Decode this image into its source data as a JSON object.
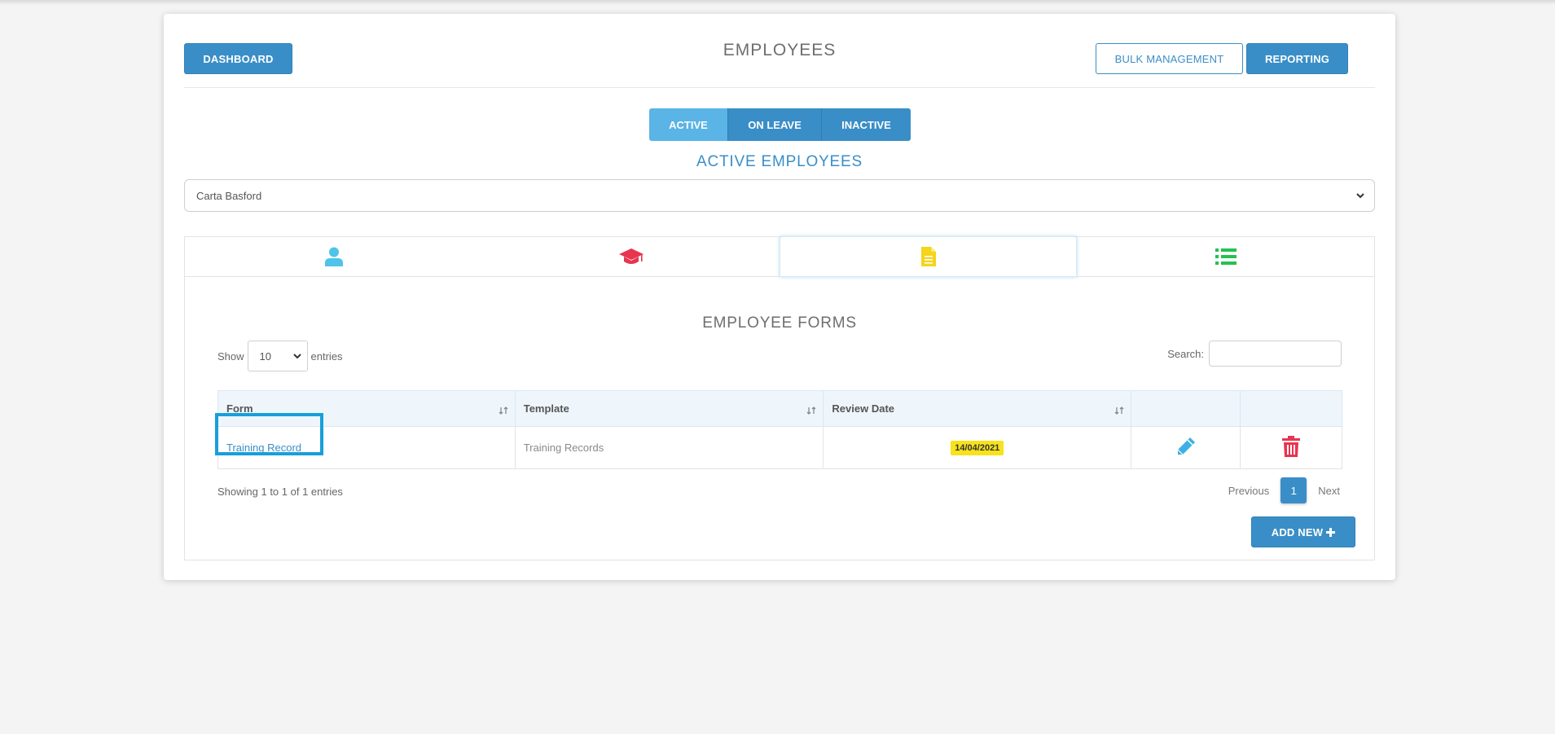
{
  "header": {
    "title": "EMPLOYEES",
    "dashboard_label": "DASHBOARD",
    "bulk_label": "BULK MANAGEMENT",
    "reporting_label": "REPORTING"
  },
  "status_tabs": [
    {
      "label": "ACTIVE",
      "selected": true
    },
    {
      "label": "ON LEAVE",
      "selected": false
    },
    {
      "label": "INACTIVE",
      "selected": false
    }
  ],
  "section_title": "ACTIVE EMPLOYEES",
  "employee_select": {
    "value": "Carta Basford"
  },
  "icon_tabs": [
    {
      "icon": "user-icon",
      "color": "#4fc3e8"
    },
    {
      "icon": "graduation-cap-icon",
      "color": "#e8344f"
    },
    {
      "icon": "document-icon",
      "color": "#f5d41a",
      "active": true
    },
    {
      "icon": "list-icon",
      "color": "#24c14f"
    }
  ],
  "forms": {
    "title": "EMPLOYEE FORMS",
    "show_label": "Show",
    "entries_label": "entries",
    "page_length": "10",
    "search_label": "Search:",
    "columns": [
      "Form",
      "Template",
      "Review Date",
      "",
      ""
    ],
    "rows": [
      {
        "form": "Training Record",
        "template": "Training Records",
        "review_date": "14/04/2021"
      }
    ],
    "info": "Showing 1 to 1 of 1 entries",
    "pager": {
      "previous": "Previous",
      "current": "1",
      "next": "Next"
    },
    "add_label": "ADD NEW"
  },
  "colors": {
    "primary": "#3a8ec7",
    "active_tab": "#5ab4e6",
    "edit": "#3fb0e3",
    "delete": "#e8344f",
    "badge": "#f7e21c"
  }
}
